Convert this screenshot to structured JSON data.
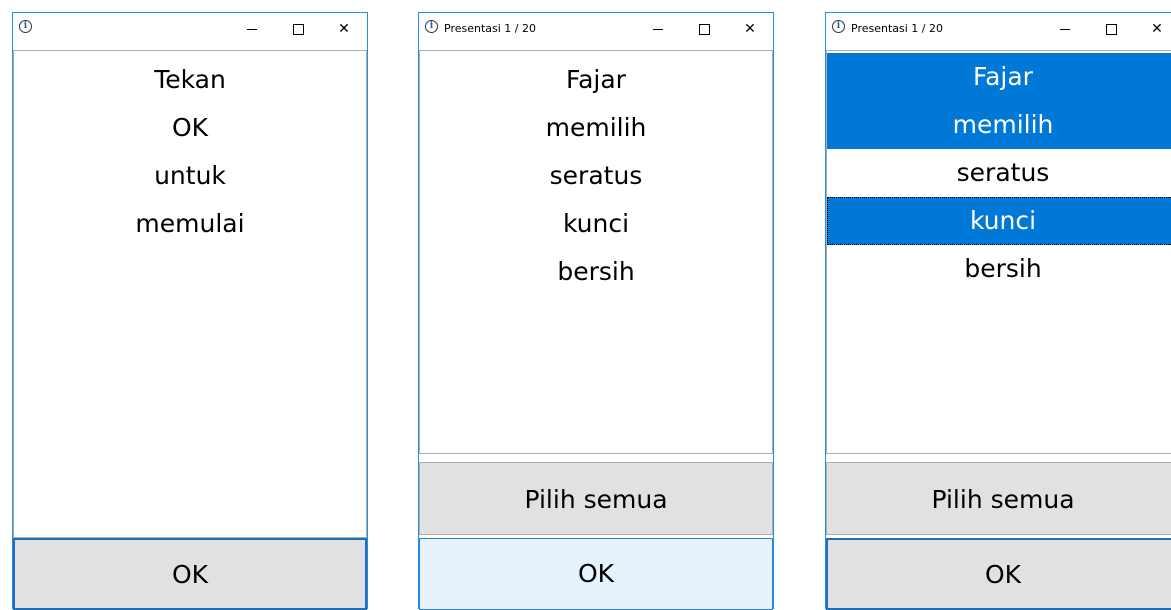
{
  "windows": [
    {
      "title": "",
      "items": [
        {
          "label": "Tekan",
          "selected": false
        },
        {
          "label": "OK",
          "selected": false
        },
        {
          "label": "untuk",
          "selected": false
        },
        {
          "label": "memulai",
          "selected": false
        }
      ],
      "ok_label": "OK"
    },
    {
      "title": "Presentasi 1 / 20",
      "items": [
        {
          "label": "Fajar",
          "selected": false
        },
        {
          "label": "memilih",
          "selected": false
        },
        {
          "label": "seratus",
          "selected": false
        },
        {
          "label": "kunci",
          "selected": false
        },
        {
          "label": "bersih",
          "selected": false
        }
      ],
      "select_all_label": "Pilih semua",
      "ok_label": "OK"
    },
    {
      "title": "Presentasi 1 / 20",
      "items": [
        {
          "label": "Fajar",
          "selected": true
        },
        {
          "label": "memilih",
          "selected": true
        },
        {
          "label": "seratus",
          "selected": false
        },
        {
          "label": "kunci",
          "selected": true
        },
        {
          "label": "bersih",
          "selected": false
        }
      ],
      "select_all_label": "Pilih semua",
      "ok_label": "OK"
    }
  ],
  "icons": {
    "app": "info-icon",
    "minimize": "minimize-icon",
    "maximize": "maximize-icon",
    "close": "close-icon"
  },
  "colors": {
    "selection": "#0078d7",
    "button_face": "#e1e1e1",
    "button_hot": "#e5f1fb",
    "window_border": "#1e90e6"
  }
}
